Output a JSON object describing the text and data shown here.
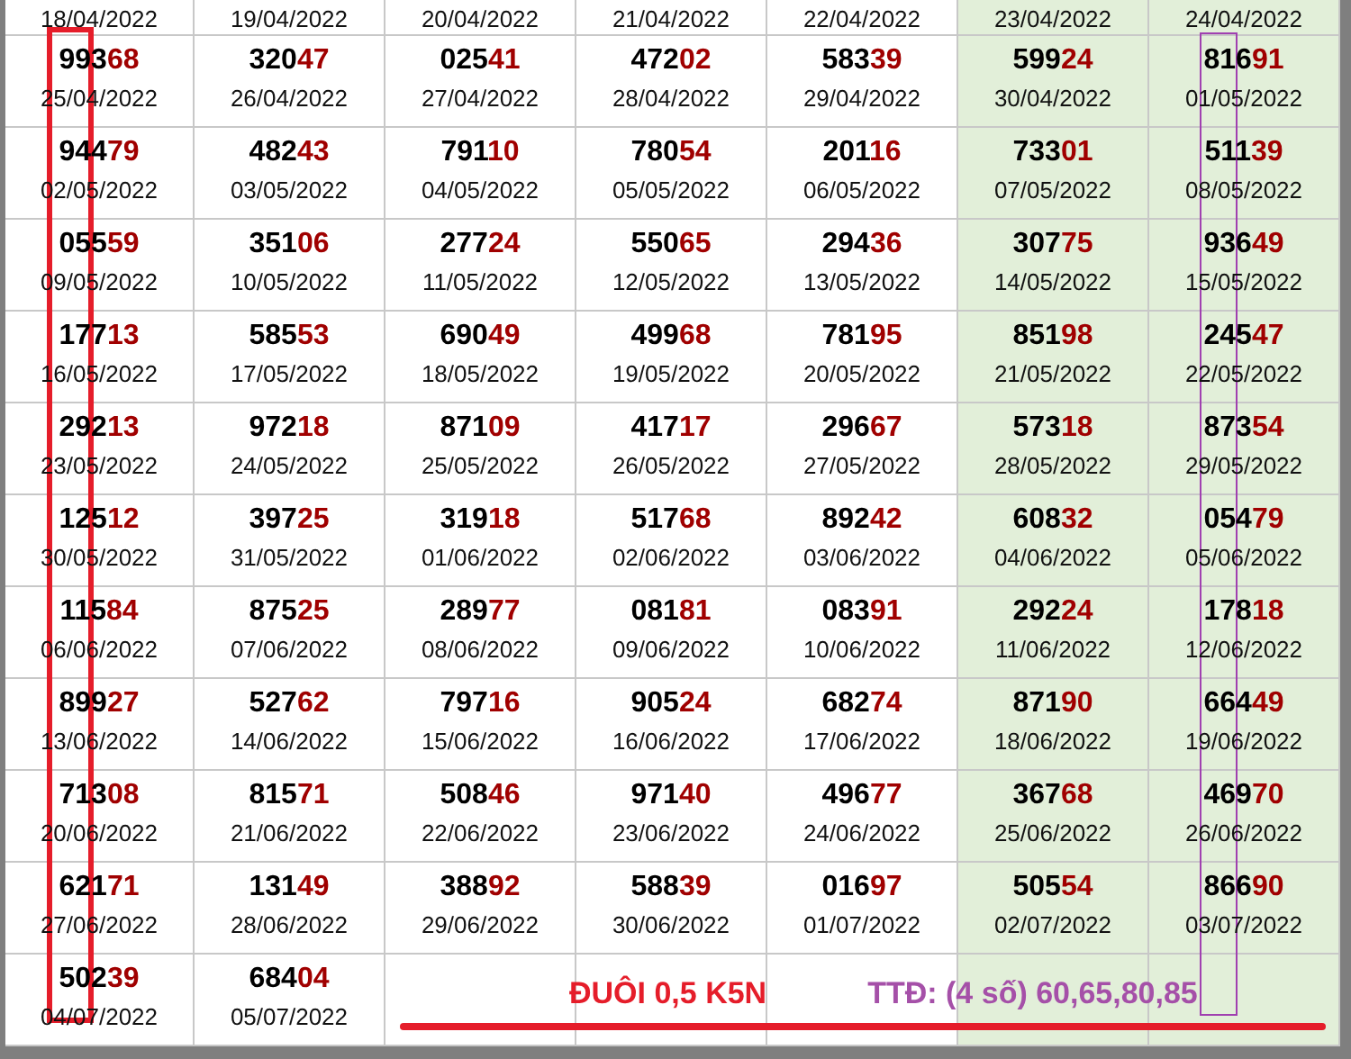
{
  "table": {
    "columns": [
      {
        "shaded": false
      },
      {
        "shaded": false
      },
      {
        "shaded": false
      },
      {
        "shaded": false
      },
      {
        "shaded": false
      },
      {
        "shaded": true
      },
      {
        "shaded": true
      }
    ],
    "header_dates": [
      "18/04/2022",
      "19/04/2022",
      "20/04/2022",
      "21/04/2022",
      "22/04/2022",
      "23/04/2022",
      "24/04/2022"
    ],
    "rows": [
      {
        "cells": [
          {
            "lead": "993",
            "tail": "68",
            "date": "25/04/2022"
          },
          {
            "lead": "320",
            "tail": "47",
            "date": "26/04/2022"
          },
          {
            "lead": "025",
            "tail": "41",
            "date": "27/04/2022"
          },
          {
            "lead": "472",
            "tail": "02",
            "date": "28/04/2022"
          },
          {
            "lead": "583",
            "tail": "39",
            "date": "29/04/2022"
          },
          {
            "lead": "599",
            "tail": "24",
            "date": "30/04/2022"
          },
          {
            "lead": "816",
            "tail": "91",
            "date": "01/05/2022"
          }
        ]
      },
      {
        "cells": [
          {
            "lead": "944",
            "tail": "79",
            "date": "02/05/2022"
          },
          {
            "lead": "482",
            "tail": "43",
            "date": "03/05/2022"
          },
          {
            "lead": "791",
            "tail": "10",
            "date": "04/05/2022"
          },
          {
            "lead": "780",
            "tail": "54",
            "date": "05/05/2022"
          },
          {
            "lead": "201",
            "tail": "16",
            "date": "06/05/2022"
          },
          {
            "lead": "733",
            "tail": "01",
            "date": "07/05/2022"
          },
          {
            "lead": "511",
            "tail": "39",
            "date": "08/05/2022"
          }
        ]
      },
      {
        "cells": [
          {
            "lead": "055",
            "tail": "59",
            "date": "09/05/2022"
          },
          {
            "lead": "351",
            "tail": "06",
            "date": "10/05/2022"
          },
          {
            "lead": "277",
            "tail": "24",
            "date": "11/05/2022"
          },
          {
            "lead": "550",
            "tail": "65",
            "date": "12/05/2022"
          },
          {
            "lead": "294",
            "tail": "36",
            "date": "13/05/2022"
          },
          {
            "lead": "307",
            "tail": "75",
            "date": "14/05/2022"
          },
          {
            "lead": "936",
            "tail": "49",
            "date": "15/05/2022"
          }
        ]
      },
      {
        "cells": [
          {
            "lead": "177",
            "tail": "13",
            "date": "16/05/2022"
          },
          {
            "lead": "585",
            "tail": "53",
            "date": "17/05/2022"
          },
          {
            "lead": "690",
            "tail": "49",
            "date": "18/05/2022"
          },
          {
            "lead": "499",
            "tail": "68",
            "date": "19/05/2022"
          },
          {
            "lead": "781",
            "tail": "95",
            "date": "20/05/2022"
          },
          {
            "lead": "851",
            "tail": "98",
            "date": "21/05/2022"
          },
          {
            "lead": "245",
            "tail": "47",
            "date": "22/05/2022"
          }
        ]
      },
      {
        "cells": [
          {
            "lead": "292",
            "tail": "13",
            "date": "23/05/2022"
          },
          {
            "lead": "972",
            "tail": "18",
            "date": "24/05/2022"
          },
          {
            "lead": "871",
            "tail": "09",
            "date": "25/05/2022"
          },
          {
            "lead": "417",
            "tail": "17",
            "date": "26/05/2022"
          },
          {
            "lead": "296",
            "tail": "67",
            "date": "27/05/2022"
          },
          {
            "lead": "573",
            "tail": "18",
            "date": "28/05/2022"
          },
          {
            "lead": "873",
            "tail": "54",
            "date": "29/05/2022"
          }
        ]
      },
      {
        "cells": [
          {
            "lead": "125",
            "tail": "12",
            "date": "30/05/2022"
          },
          {
            "lead": "397",
            "tail": "25",
            "date": "31/05/2022"
          },
          {
            "lead": "319",
            "tail": "18",
            "date": "01/06/2022"
          },
          {
            "lead": "517",
            "tail": "68",
            "date": "02/06/2022"
          },
          {
            "lead": "892",
            "tail": "42",
            "date": "03/06/2022"
          },
          {
            "lead": "608",
            "tail": "32",
            "date": "04/06/2022"
          },
          {
            "lead": "054",
            "tail": "79",
            "date": "05/06/2022"
          }
        ]
      },
      {
        "cells": [
          {
            "lead": "115",
            "tail": "84",
            "date": "06/06/2022"
          },
          {
            "lead": "875",
            "tail": "25",
            "date": "07/06/2022"
          },
          {
            "lead": "289",
            "tail": "77",
            "date": "08/06/2022"
          },
          {
            "lead": "081",
            "tail": "81",
            "date": "09/06/2022"
          },
          {
            "lead": "083",
            "tail": "91",
            "date": "10/06/2022"
          },
          {
            "lead": "292",
            "tail": "24",
            "date": "11/06/2022"
          },
          {
            "lead": "178",
            "tail": "18",
            "date": "12/06/2022"
          }
        ]
      },
      {
        "cells": [
          {
            "lead": "899",
            "tail": "27",
            "date": "13/06/2022"
          },
          {
            "lead": "527",
            "tail": "62",
            "date": "14/06/2022"
          },
          {
            "lead": "797",
            "tail": "16",
            "date": "15/06/2022"
          },
          {
            "lead": "905",
            "tail": "24",
            "date": "16/06/2022"
          },
          {
            "lead": "682",
            "tail": "74",
            "date": "17/06/2022"
          },
          {
            "lead": "871",
            "tail": "90",
            "date": "18/06/2022"
          },
          {
            "lead": "664",
            "tail": "49",
            "date": "19/06/2022"
          }
        ]
      },
      {
        "cells": [
          {
            "lead": "713",
            "tail": "08",
            "date": "20/06/2022"
          },
          {
            "lead": "815",
            "tail": "71",
            "date": "21/06/2022"
          },
          {
            "lead": "508",
            "tail": "46",
            "date": "22/06/2022"
          },
          {
            "lead": "971",
            "tail": "40",
            "date": "23/06/2022"
          },
          {
            "lead": "496",
            "tail": "77",
            "date": "24/06/2022"
          },
          {
            "lead": "367",
            "tail": "68",
            "date": "25/06/2022"
          },
          {
            "lead": "469",
            "tail": "70",
            "date": "26/06/2022"
          }
        ]
      },
      {
        "cells": [
          {
            "lead": "621",
            "tail": "71",
            "date": "27/06/2022"
          },
          {
            "lead": "131",
            "tail": "49",
            "date": "28/06/2022"
          },
          {
            "lead": "388",
            "tail": "92",
            "date": "29/06/2022"
          },
          {
            "lead": "588",
            "tail": "39",
            "date": "30/06/2022"
          },
          {
            "lead": "016",
            "tail": "97",
            "date": "01/07/2022"
          },
          {
            "lead": "505",
            "tail": "54",
            "date": "02/07/2022"
          },
          {
            "lead": "866",
            "tail": "90",
            "date": "03/07/2022"
          }
        ]
      },
      {
        "cells": [
          {
            "lead": "502",
            "tail": "39",
            "date": "04/07/2022"
          },
          {
            "lead": "684",
            "tail": "04",
            "date": "05/07/2022"
          }
        ]
      }
    ]
  },
  "note": {
    "title": "ĐUÔI 0,5 K5N",
    "detail": "TTĐ: (4 số) 60,65,80,85"
  }
}
